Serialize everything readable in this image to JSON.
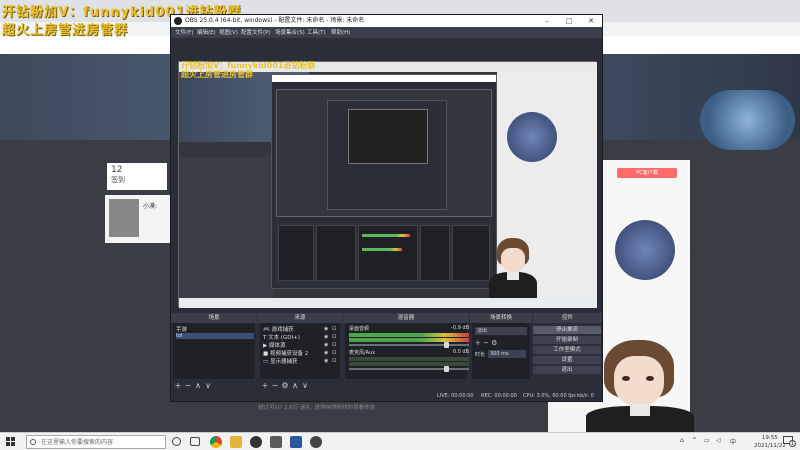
{
  "overlay": {
    "line1": "开钻粉加V：funnykid001进钻粉群",
    "line2": "超火上房管进房管群",
    "line1_nested": "开钻粉加V：funnykid001进钻粉群",
    "line2_nested": "超火上房管进房管群",
    "ticker_text": "超过可以!  2.6万 送礼, 送得纯领粉线的观看体验"
  },
  "background_site": {
    "stat_number": "12",
    "stat_label": "签到",
    "user_name": "小漠:",
    "right_badge": "PC客户端",
    "time": "2021/11/22"
  },
  "obs": {
    "title": "OBS 25.0.4 (64-bit, windows) - 配置文件: 未命名 - 场景: 未命名",
    "window_buttons": [
      "–",
      "□",
      "✕"
    ],
    "menu": [
      "文件(F)",
      "编辑(E)",
      "视图(V)",
      "配置文件(P)",
      "场景集合(S)",
      "工具(T)",
      "帮助(H)"
    ],
    "docks": {
      "scenes": {
        "title": "场景",
        "items": [
          "手游",
          "lol"
        ],
        "selected_index": 1
      },
      "sources": {
        "title": "来源",
        "items": [
          "游戏捕获",
          "文本 (GDI+)",
          "媒体源",
          "视频捕获设备 2",
          "显示器捕获"
        ]
      },
      "mixer": {
        "title": "混音器",
        "tracks": [
          {
            "name": "桌面音频",
            "db": "-0.9 dB",
            "level": 0.8
          },
          {
            "name": "麦克风/Aux",
            "db": "0.0 dB",
            "level": 0.6
          }
        ]
      },
      "transitions": {
        "title": "场景转换",
        "type": "淡出",
        "duration_label": "时长",
        "duration_value": "300 ms"
      },
      "controls": {
        "title": "控件",
        "buttons": [
          "停止推流",
          "开始录制",
          "工作室模式",
          "设置",
          "退出"
        ],
        "primary_index": 0
      }
    },
    "status": {
      "live": "LIVE: 00:00:00",
      "rec": "REC: 00:00:00",
      "cpu": "CPU: 3.0%, 60.00 fps",
      "kbps": "kb/s: 0"
    },
    "footer_buttons": [
      "+",
      "−",
      "∧",
      "∨"
    ]
  },
  "taskbar": {
    "search_placeholder": "在这里输入你要搜索的内容",
    "clock_time": "19:55",
    "clock_date": "2021/11/22",
    "notif_count": "1"
  },
  "colors": {
    "overlay_text": "#e8c230",
    "obs_bg": "#2b2e38",
    "obs_panel": "#1f2127",
    "selection": "#3b4f78"
  },
  "icons": [
    "windows-start-icon",
    "search-icon",
    "chrome-icon",
    "folder-icon",
    "obs-icon",
    "notification-icon"
  ]
}
